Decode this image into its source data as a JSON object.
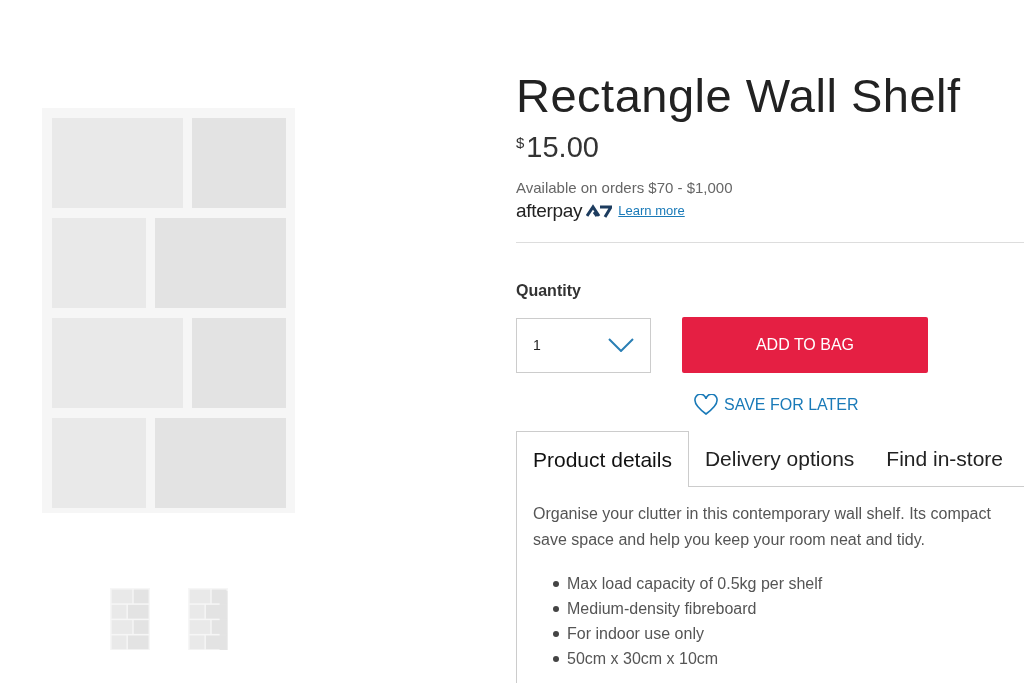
{
  "product": {
    "title": "Rectangle Wall Shelf",
    "currency": "$",
    "price": "15.00",
    "availability": "Available on orders $70 - $1,000",
    "afterpay_logo": "afterpay",
    "learn_more": "Learn more"
  },
  "thumbnails": [
    {
      "kind": "picture",
      "selected": false
    },
    {
      "kind": "picture",
      "selected": false
    }
  ],
  "quantity": {
    "label": "Quantity",
    "value": "1"
  },
  "add_to_bag": "ADD TO BAG",
  "save_for_later": "SAVE FOR LATER",
  "tabs": [
    {
      "label": "Product details",
      "selected": true
    },
    {
      "label": "Delivery options",
      "selected": false
    },
    {
      "label": "Find in-store",
      "selected": false
    }
  ],
  "description_lines": [
    "Organise your clutter in this contemporary wall shelf. Its compact",
    "save space and help you keep your room neat and tidy."
  ],
  "features": [
    "Max load capacity of 0.5kg per shelf",
    "Medium-density fibreboard",
    "For indoor use only",
    "50cm x 30cm x 10cm"
  ]
}
